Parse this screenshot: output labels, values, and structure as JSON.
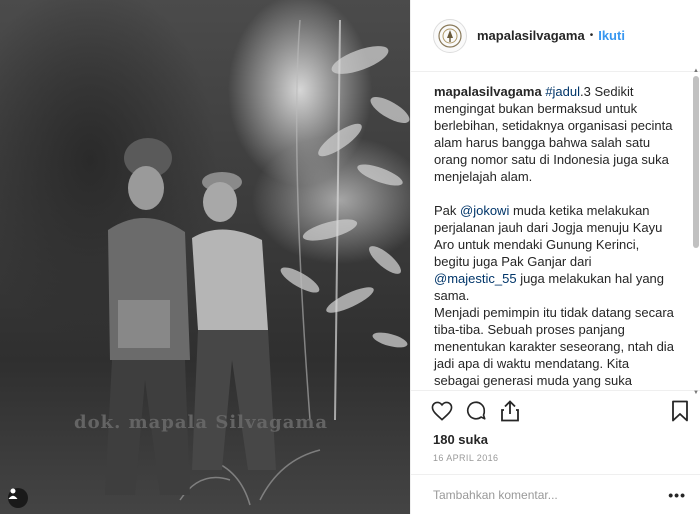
{
  "photo": {
    "watermark": "dok. mapala Silvagama",
    "user_tag_icon": "person-icon"
  },
  "header": {
    "username": "mapalasilvagama",
    "separator": "•",
    "follow_label": "Ikuti"
  },
  "caption": {
    "username": "mapalasilvagama",
    "hashtag": "#jadul",
    "p1_rest": ".3 Sedikit mengingat bukan bermaksud untuk berlebihan, setidaknya organisasi pecinta alam harus bangga bahwa salah satu orang nomor satu di Indonesia juga suka menjelajah alam.",
    "p2_a": "Pak ",
    "mention1": "@jokowi",
    "p2_b": " muda ketika melakukan perjalanan jauh dari Jogja menuju Kayu Aro untuk mendaki Gunung Kerinci, begitu juga Pak Ganjar dari ",
    "mention2": "@majestic_55",
    "p2_c": " juga melakukan hal yang sama.",
    "p3": "Menjadi pemimpin itu tidak datang secara tiba-tiba. Sebuah proses panjang menentukan karakter seseorang, ntah dia jadi apa di waktu mendatang. Kita sebagai generasi muda yang suka menjelajah negeri memiliki keyakinan yang besar, bahwa suatu saat nanti kita dapat bermanfaat dan mengabdi secara penuh untuk bangsa dan"
  },
  "actions": {
    "icons": [
      "heart-icon",
      "comment-icon",
      "share-icon",
      "bookmark-icon"
    ]
  },
  "likes": "180 suka",
  "date": "16 APRIL 2016",
  "comment": {
    "placeholder": "Tambahkan komentar...",
    "more_label": "•••"
  }
}
